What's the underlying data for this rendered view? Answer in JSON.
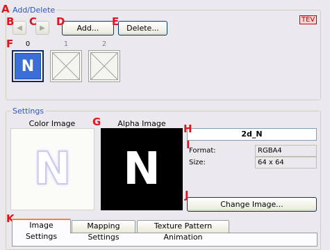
{
  "markers": [
    "A",
    "B",
    "C",
    "D",
    "E",
    "F",
    "G",
    "H",
    "I",
    "J",
    "K"
  ],
  "add_delete": {
    "title": "Add/Delete",
    "badge": "TEV",
    "prev_icon": "triangle-left-icon",
    "next_icon": "triangle-right-icon",
    "add_label": "Add...",
    "delete_label": "Delete...",
    "slots": [
      {
        "index": "0",
        "thumb": "N",
        "state": "selected"
      },
      {
        "index": "1",
        "state": "empty"
      },
      {
        "index": "2",
        "state": "empty"
      }
    ]
  },
  "settings": {
    "title": "Settings",
    "color_image_label": "Color Image",
    "alpha_image_label": "Alpha Image",
    "preview_glyph": "N",
    "texture_name": "2d_N",
    "format_label": "Format:",
    "format_value": "RGBA4",
    "size_label": "Size:",
    "size_value": "64 x 64",
    "change_image_label": "Change Image..."
  },
  "tabs": [
    {
      "label": "Image Settings",
      "active": true
    },
    {
      "label": "Mapping Settings",
      "active": false
    },
    {
      "label": "Texture Pattern Animation",
      "active": false
    }
  ],
  "colors": {
    "accent_title": "#2856c8",
    "marker": "#e0141e",
    "selected_thumb": "#3b6fd6",
    "tev_badge_bg": "#ffd2d2"
  }
}
